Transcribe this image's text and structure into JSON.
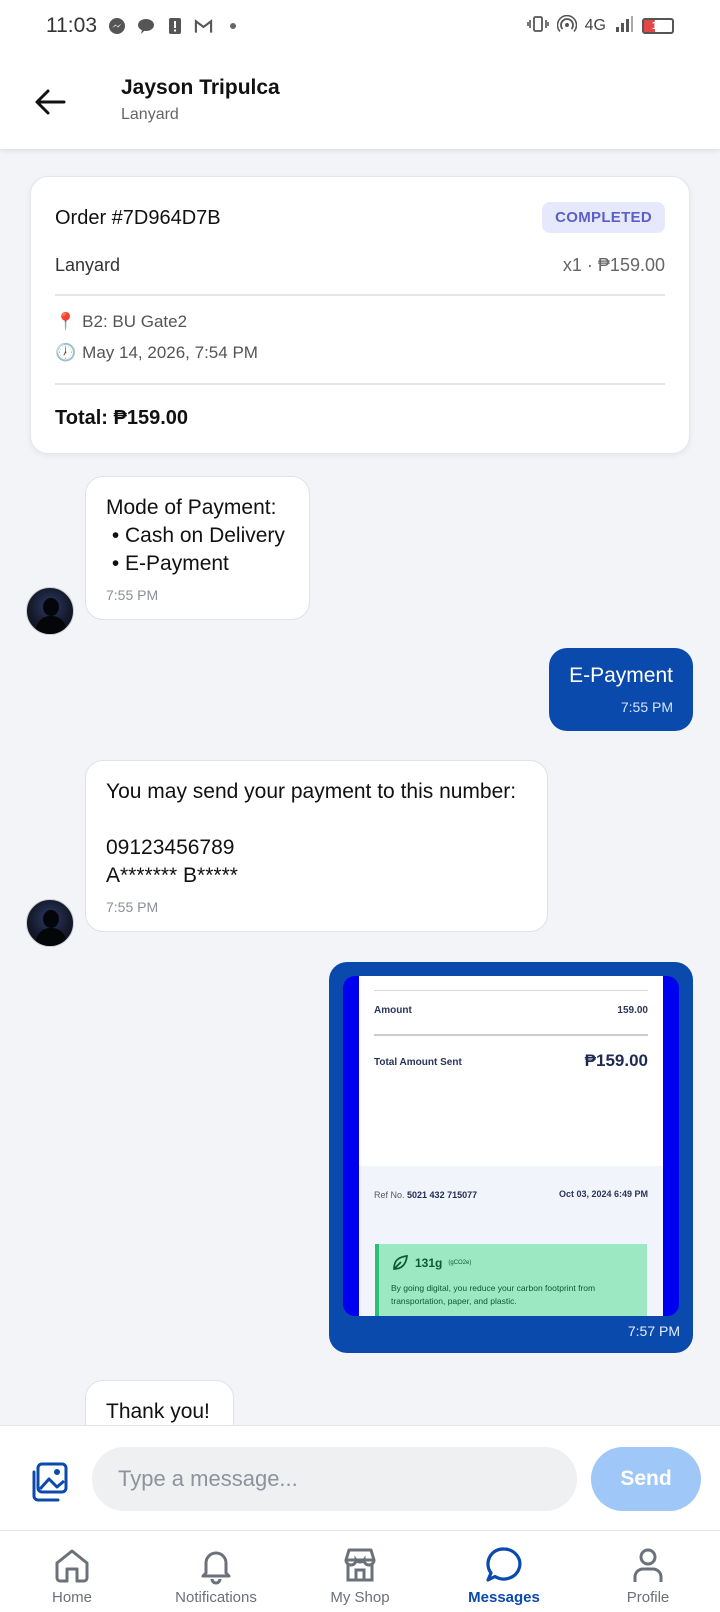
{
  "status_bar": {
    "time": "11:03",
    "network": "4G",
    "battery": "17",
    "notification_icons": [
      "messenger-icon",
      "chat-icon",
      "alert-icon",
      "gmail-icon",
      "dot-icon"
    ]
  },
  "header": {
    "title": "Jayson Tripulca",
    "subtitle": "Lanyard"
  },
  "order": {
    "title": "Order #7D964D7B",
    "status": "COMPLETED",
    "status_color": "#5b5fc7",
    "item_name": "Lanyard",
    "item_qty_price": "x1 · ₱159.00",
    "location_icon": "📍",
    "location": "B2: BU Gate2",
    "time_icon": "🕖",
    "datetime": "May 14, 2026, 7:54 PM",
    "total": "Total: ₱159.00"
  },
  "messages": [
    {
      "direction": "incoming",
      "lines": [
        "Mode of Payment:",
        " • Cash on Delivery",
        " • E-Payment"
      ],
      "time": "7:55 PM"
    },
    {
      "direction": "outgoing",
      "text": "E-Payment",
      "time": "7:55 PM"
    },
    {
      "direction": "incoming",
      "lines": [
        "You may send your payment to this number:",
        " ",
        "09123456789",
        "A******* B*****"
      ],
      "time": "7:55 PM"
    },
    {
      "direction": "outgoing",
      "type": "image",
      "receipt": {
        "amount_label": "Amount",
        "amount_value": "159.00",
        "total_label": "Total Amount Sent",
        "total_value": "₱159.00",
        "ref_label": "Ref No.",
        "ref_value": "5021 432 715077",
        "date": "Oct 03, 2024 6:49 PM",
        "eco_amount": "131g",
        "eco_unit": "(gCO2e)",
        "eco_text": "By going digital, you reduce your carbon footprint from transportation, paper, and plastic."
      },
      "time": "7:57 PM"
    },
    {
      "direction": "incoming",
      "text": "Thank you!"
    }
  ],
  "composer": {
    "placeholder": "Type a message...",
    "send_label": "Send"
  },
  "nav": {
    "items": [
      {
        "label": "Home",
        "icon": "home-icon"
      },
      {
        "label": "Notifications",
        "icon": "bell-icon"
      },
      {
        "label": "My Shop",
        "icon": "shop-icon"
      },
      {
        "label": "Messages",
        "icon": "chat-bubble-icon",
        "active": true
      },
      {
        "label": "Profile",
        "icon": "user-icon"
      }
    ],
    "active_color": "#0a4aad"
  },
  "colors": {
    "accent": "#0a4aad",
    "send_disabled": "#9fc7f7",
    "background": "#f2f4f7"
  }
}
